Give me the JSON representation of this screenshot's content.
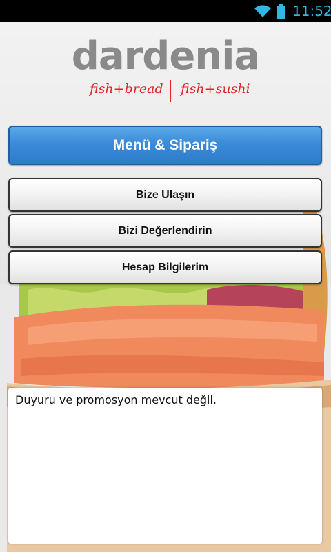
{
  "status_bar": {
    "time": "11:52"
  },
  "logo": {
    "wordmark": "dardenia",
    "left_tagline": "fish+bread",
    "right_tagline": "fish+sushi"
  },
  "menu": {
    "primary": "Menü & Sipariş",
    "contact": "Bize Ulaşın",
    "rate": "Bizi Değerlendirin",
    "account": "Hesap Bilgilerim"
  },
  "announcements": {
    "empty_text": "Duyuru ve promosyon mevcut değil."
  },
  "colors": {
    "status_accent": "#33b5e5",
    "primary_button": "#3a8bd9",
    "brand_red": "#e3252a",
    "logo_gray": "#8a8a8a"
  }
}
